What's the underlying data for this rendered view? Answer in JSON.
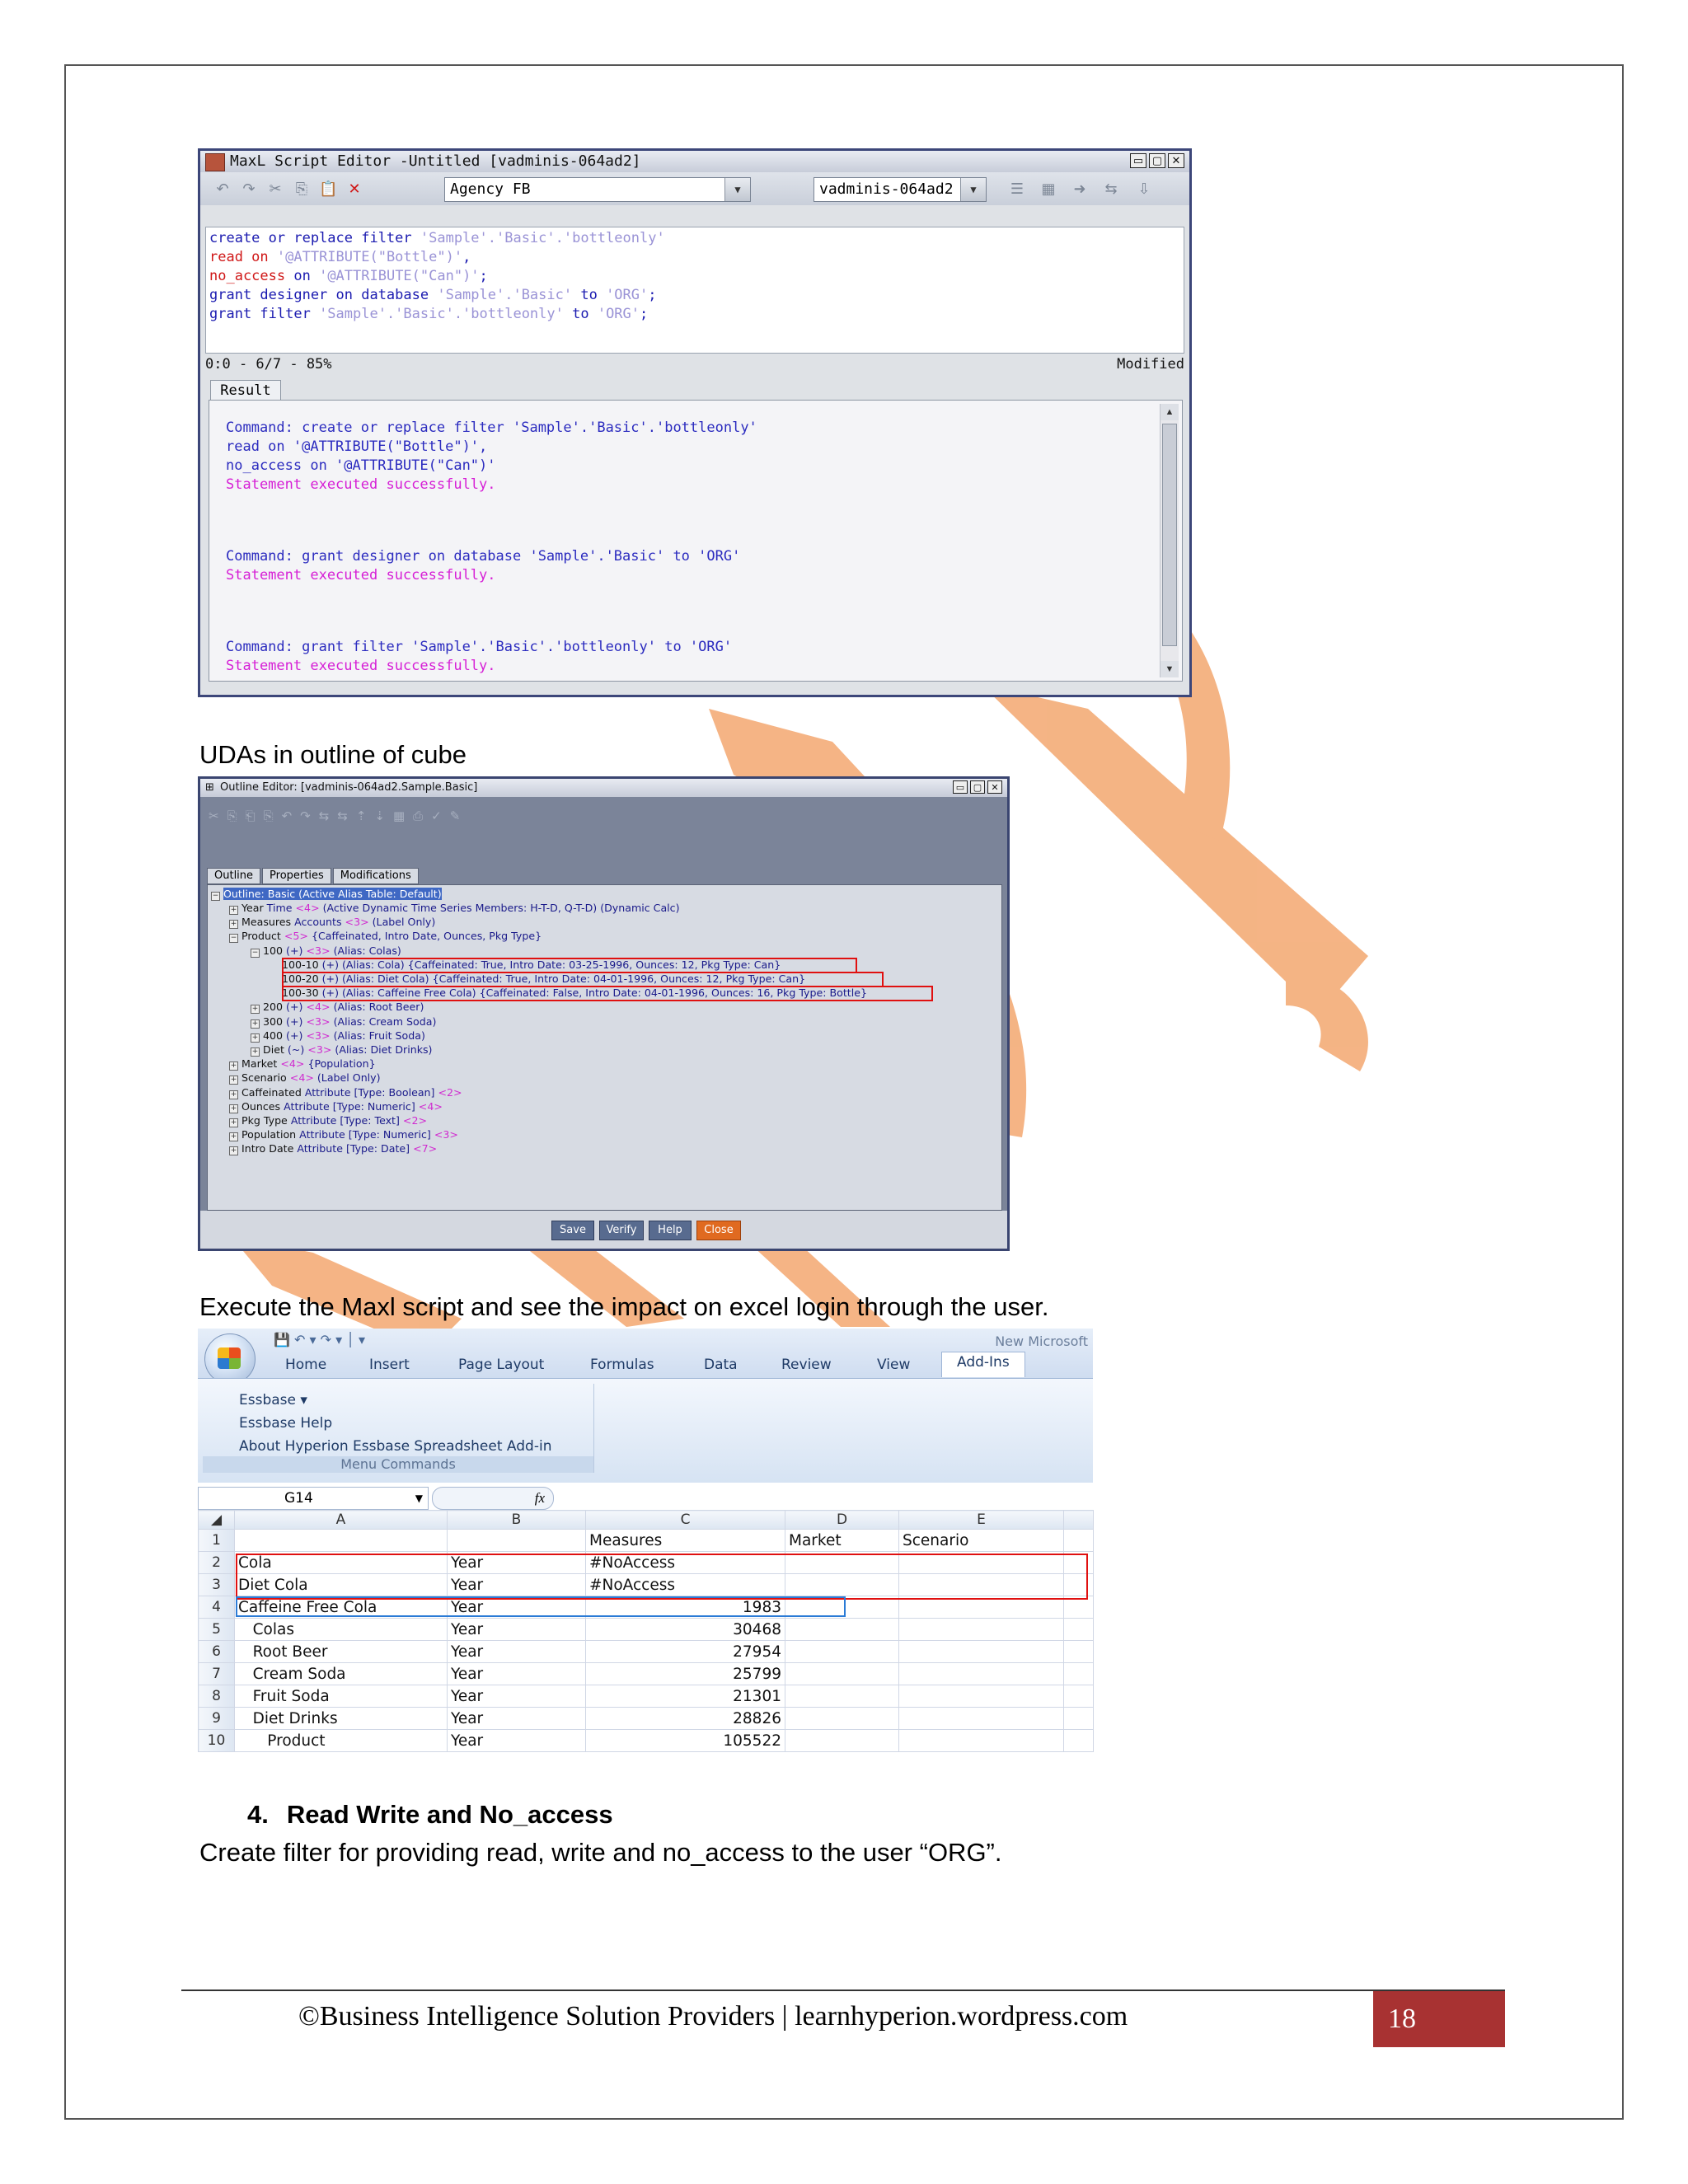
{
  "maxl_editor": {
    "title": "MaxL Script Editor -Untitled [vadminis-064ad2]",
    "app_combo": "Agency FB",
    "server_combo": "vadminis-064ad2",
    "script_lines": [
      [
        "create or replace filter ",
        "'Sample'.'Basic'.'bottleonly'"
      ],
      [
        "read on ",
        "'@ATTRIBUTE(\"Bottle\")'",
        ","
      ],
      [
        "no_access",
        " on ",
        "'@ATTRIBUTE(\"Can\")'",
        ";"
      ],
      [
        "grant designer on database ",
        "'Sample'.'Basic'",
        " to ",
        "'ORG'",
        ";"
      ],
      [
        "grant filter ",
        "'Sample'.'Basic'.'bottleonly'",
        " to ",
        "'ORG'",
        ";"
      ]
    ],
    "status_left": "0:0 - 6/7 - 85%",
    "status_right": "Modified",
    "result_tab": "Result",
    "results": {
      "c1a": "Command: create or replace filter 'Sample'.'Basic'.'bottleonly'",
      "c1b": "read on '@ATTRIBUTE(\"Bottle\")',",
      "c1c": "no_access on '@ATTRIBUTE(\"Can\")'",
      "ok1": "Statement executed successfully.",
      "c2": "Command: grant designer on database 'Sample'.'Basic' to 'ORG'",
      "ok2": "Statement executed successfully.",
      "c3": "Command: grant filter 'Sample'.'Basic'.'bottleonly' to 'ORG'",
      "ok3": "Statement executed successfully."
    }
  },
  "text1": "UDAs in outline of cube",
  "outline_editor": {
    "title": "Outline Editor: [vadminis-064ad2.Sample.Basic]",
    "tabs": [
      "Outline",
      "Properties",
      "Modifications"
    ],
    "root": "Outline: Basic (Active Alias Table: Default)",
    "rows": [
      {
        "n": "Year",
        "b": " Time ",
        "g": "<4>",
        "r": " (Active Dynamic Time Series Members: H-T-D, Q-T-D) (Dynamic Calc)"
      },
      {
        "n": "Measures",
        "b": " Accounts ",
        "g": "<3>",
        "r": " (Label Only)"
      },
      {
        "n": "Product",
        "b": " ",
        "g": "<5>",
        "r": " {Caffeinated, Intro Date, Ounces, Pkg Type}"
      },
      {
        "n": "100",
        "b": " (+) ",
        "g": "<3>",
        "r": " (Alias: Colas)"
      },
      {
        "n": "100-10",
        "b": " (+) (Alias: Cola) {Caffeinated: True, Intro Date: 03-25-1996, Ounces: 12, Pkg Type: Can}",
        "g": "",
        "r": ""
      },
      {
        "n": "100-20",
        "b": " (+) (Alias: Diet Cola) {Caffeinated: True, Intro Date: 04-01-1996, Ounces: 12, Pkg Type: Can}",
        "g": "",
        "r": ""
      },
      {
        "n": "100-30",
        "b": " (+) (Alias: Caffeine Free Cola) {Caffeinated: False, Intro Date: 04-01-1996, Ounces: 16, Pkg Type: Bottle}",
        "g": "",
        "r": ""
      },
      {
        "n": "200",
        "b": " (+) ",
        "g": "<4>",
        "r": " (Alias: Root Beer)"
      },
      {
        "n": "300",
        "b": " (+) ",
        "g": "<3>",
        "r": " (Alias: Cream Soda)"
      },
      {
        "n": "400",
        "b": " (+) ",
        "g": "<3>",
        "r": " (Alias: Fruit Soda)"
      },
      {
        "n": "Diet",
        "b": " (~) ",
        "g": "<3>",
        "r": " (Alias: Diet Drinks)"
      },
      {
        "n": "Market",
        "b": " ",
        "g": "<4>",
        "r": " {Population}"
      },
      {
        "n": "Scenario",
        "b": " ",
        "g": "<4>",
        "r": " (Label Only)"
      },
      {
        "n": "Caffeinated",
        "b": " Attribute [Type: Boolean] ",
        "g": "<2>",
        "r": ""
      },
      {
        "n": "Ounces",
        "b": " Attribute [Type: Numeric] ",
        "g": "<4>",
        "r": ""
      },
      {
        "n": "Pkg Type",
        "b": " Attribute [Type: Text] ",
        "g": "<2>",
        "r": ""
      },
      {
        "n": "Population",
        "b": " Attribute [Type: Numeric] ",
        "g": "<3>",
        "r": ""
      },
      {
        "n": "Intro Date",
        "b": " Attribute [Type: Date] ",
        "g": "<7>",
        "r": ""
      }
    ],
    "buttons": [
      "Save",
      "Verify",
      "Help",
      "Close"
    ]
  },
  "text2": "Execute the Maxl script and see the impact on excel login through the user.",
  "excel": {
    "window_title": "New Microsoft",
    "tabs": [
      "Home",
      "Insert",
      "Page Layout",
      "Formulas",
      "Data",
      "Review",
      "View",
      "Add-Ins"
    ],
    "menu_items": [
      "Essbase ▾",
      "Essbase Help",
      "About Hyperion Essbase Spreadsheet Add-in"
    ],
    "menu_caption": "Menu Commands",
    "name_box": "G14",
    "fx": "fx",
    "col_headers": [
      "A",
      "B",
      "C",
      "D",
      "E"
    ],
    "rows": [
      [
        "1",
        "",
        "",
        "Measures",
        "Market",
        "Scenario"
      ],
      [
        "2",
        "Cola",
        "Year",
        "#NoAccess",
        "",
        ""
      ],
      [
        "3",
        "Diet Cola",
        "Year",
        "#NoAccess",
        "",
        ""
      ],
      [
        "4",
        "Caffeine Free Cola",
        "Year",
        "1983",
        "",
        ""
      ],
      [
        "5",
        "   Colas",
        "Year",
        "30468",
        "",
        ""
      ],
      [
        "6",
        "   Root Beer",
        "Year",
        "27954",
        "",
        ""
      ],
      [
        "7",
        "   Cream Soda",
        "Year",
        "25799",
        "",
        ""
      ],
      [
        "8",
        "   Fruit Soda",
        "Year",
        "21301",
        "",
        ""
      ],
      [
        "9",
        "   Diet Drinks",
        "Year",
        "28826",
        "",
        ""
      ],
      [
        "10",
        "      Product",
        "Year",
        "105522",
        "",
        ""
      ]
    ]
  },
  "section": {
    "number": "4.",
    "title": "Read Write and No_access"
  },
  "text3": "Create filter for providing read, write and no_access to the user “ORG”.",
  "footer": {
    "text": "©Business Intelligence Solution Providers | learnhyperion.wordpress.com",
    "page": "18"
  },
  "colors": {
    "watermark": "#f4b07e",
    "page_number_bg": "#a83232",
    "highlight_red": "#e01010"
  }
}
